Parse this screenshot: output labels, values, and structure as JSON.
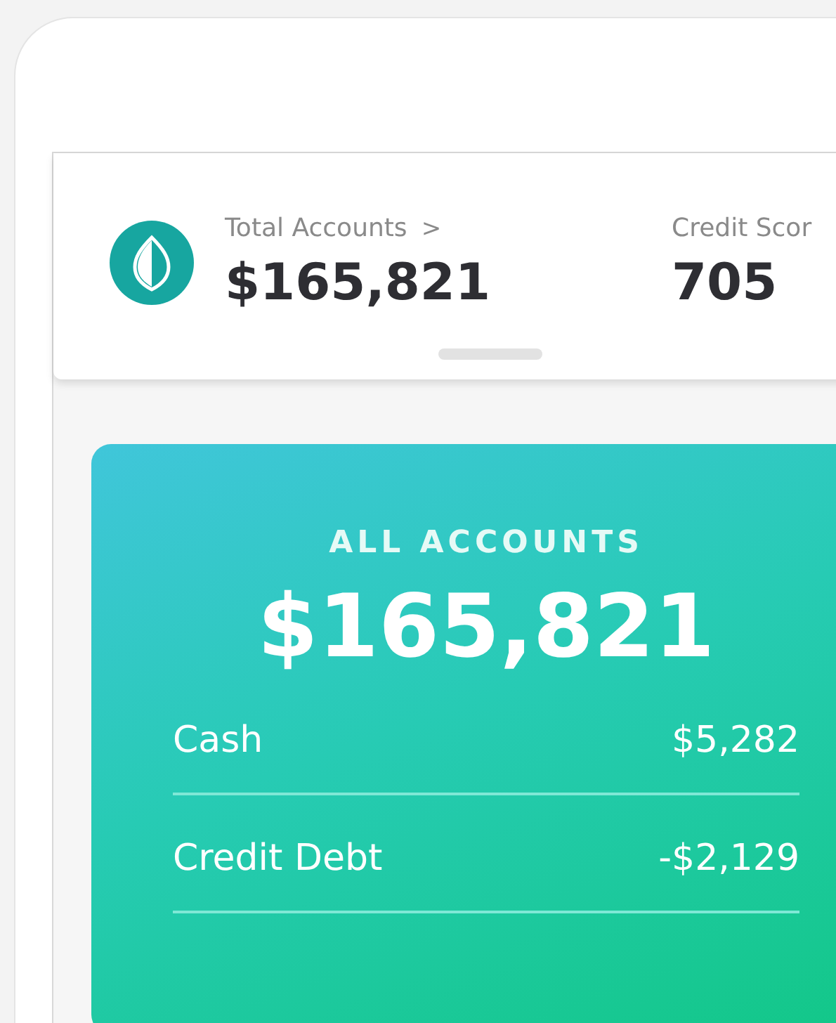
{
  "summary_bar": {
    "items": [
      {
        "label": "Total Accounts",
        "chevron": ">",
        "value": "$165,821"
      },
      {
        "label": "Credit Scor",
        "value": "705"
      }
    ]
  },
  "accounts_card": {
    "title": "ALL ACCOUNTS",
    "total": "$165,821",
    "rows": [
      {
        "label": "Cash",
        "amount": "$5,282"
      },
      {
        "label": "Credit Debt",
        "amount": "-$2,129"
      }
    ]
  }
}
